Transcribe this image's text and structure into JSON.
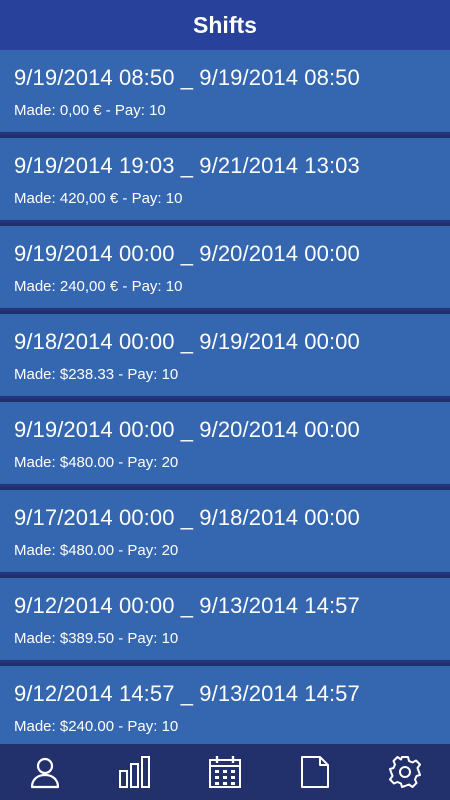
{
  "header": {
    "title": "Shifts"
  },
  "shifts": [
    {
      "range": "9/19/2014 08:50 _ 9/19/2014 08:50",
      "made": "Made: 0,00 € - Pay: 10"
    },
    {
      "range": "9/19/2014 19:03 _ 9/21/2014 13:03",
      "made": "Made: 420,00 € - Pay: 10"
    },
    {
      "range": "9/19/2014 00:00 _ 9/20/2014 00:00",
      "made": "Made: 240,00 € - Pay: 10"
    },
    {
      "range": "9/18/2014 00:00 _ 9/19/2014 00:00",
      "made": "Made: $238.33 - Pay: 10"
    },
    {
      "range": "9/19/2014 00:00 _ 9/20/2014 00:00",
      "made": "Made: $480.00 - Pay: 20"
    },
    {
      "range": "9/17/2014 00:00 _ 9/18/2014 00:00",
      "made": "Made: $480.00 - Pay: 20"
    },
    {
      "range": "9/12/2014 00:00 _ 9/13/2014 14:57",
      "made": "Made: $389.50 - Pay: 10"
    },
    {
      "range": "9/12/2014 14:57 _ 9/13/2014 14:57",
      "made": "Made: $240.00 - Pay: 10"
    }
  ],
  "bottom_nav": [
    {
      "icon": "user-icon"
    },
    {
      "icon": "bar-chart-icon"
    },
    {
      "icon": "calendar-icon"
    },
    {
      "icon": "document-icon"
    },
    {
      "icon": "gear-icon"
    }
  ],
  "colors": {
    "header_bg": "#28419a",
    "row_bg": "#3566b0",
    "divider": "#22367d",
    "nav_bg": "#22306b",
    "text": "#ffffff"
  }
}
